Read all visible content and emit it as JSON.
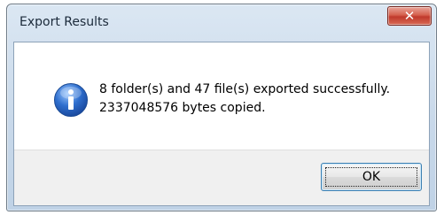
{
  "window": {
    "title": "Export Results",
    "close_label": "✕"
  },
  "dialog": {
    "icon": "info-icon",
    "message_line1": "8 folder(s) and 47 file(s) exported successfully.",
    "message_line2": "2337048576 bytes copied.",
    "ok_label": "OK"
  },
  "colors": {
    "icon_blue": "#2f6fce",
    "close_red": "#c0392b",
    "button_border": "#3c7fb1"
  }
}
